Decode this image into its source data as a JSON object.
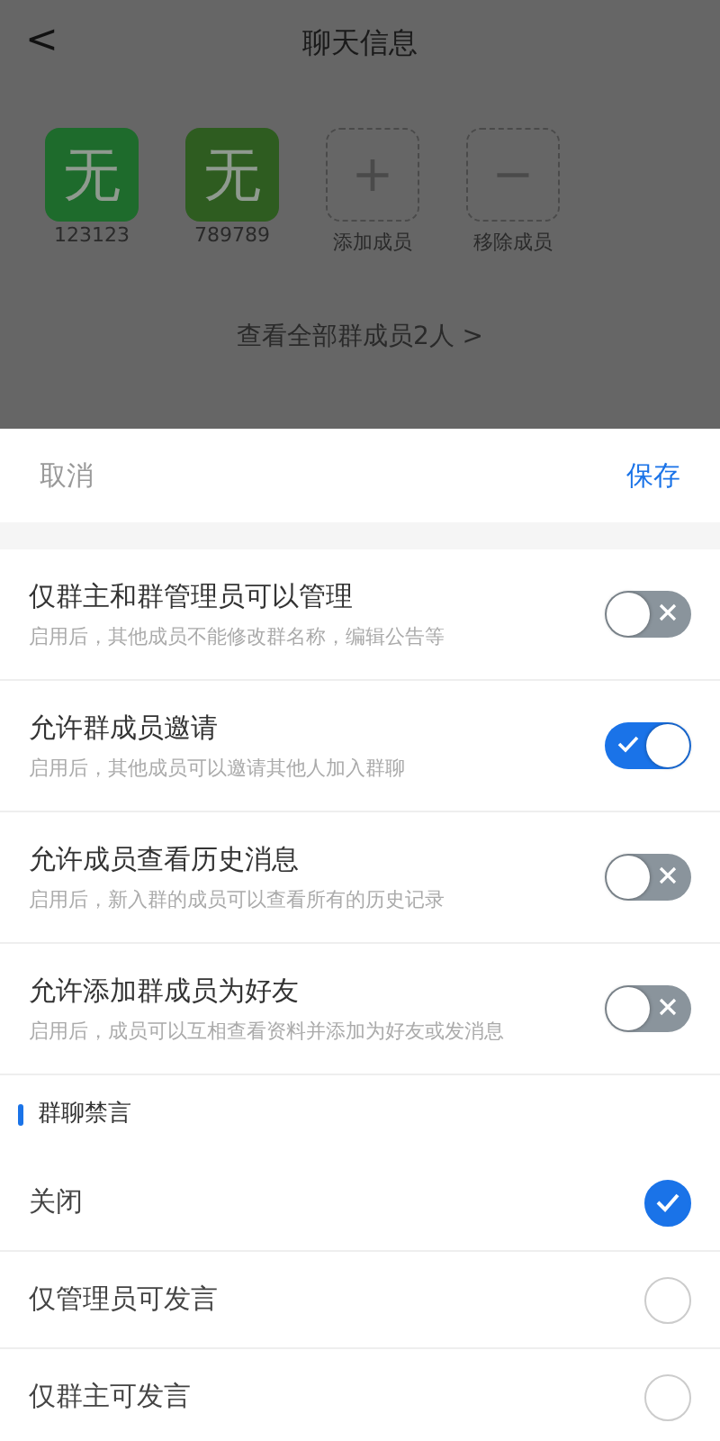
{
  "header": {
    "back": "<",
    "title": "聊天信息"
  },
  "members": [
    {
      "kind": "avatar",
      "glyph": "无",
      "label": "123123",
      "color": "#1e6b2c"
    },
    {
      "kind": "avatar",
      "glyph": "无",
      "label": "789789",
      "color": "#2e5c20"
    },
    {
      "kind": "add",
      "glyph": "+",
      "label": "添加成员"
    },
    {
      "kind": "remove",
      "glyph": "−",
      "label": "移除成员"
    }
  ],
  "view_all": {
    "text": "查看全部群成员2人",
    "chevron": ">"
  },
  "sheet": {
    "cancel": "取消",
    "save": "保存",
    "settings": [
      {
        "title": "仅群主和群管理员可以管理",
        "hint": "启用后，其他成员不能修改群名称，编辑公告等",
        "on": false
      },
      {
        "title": "允许群成员邀请",
        "hint": "启用后，其他成员可以邀请其他人加入群聊",
        "on": true
      },
      {
        "title": "允许成员查看历史消息",
        "hint": "启用后，新入群的成员可以查看所有的历史记录",
        "on": false
      },
      {
        "title": "允许添加群成员为好友",
        "hint": "启用后，成员可以互相查看资料并添加为好友或发消息",
        "on": false
      }
    ],
    "mute_section": "群聊禁言",
    "mute_options": [
      {
        "label": "关闭",
        "selected": true
      },
      {
        "label": "仅管理员可发言",
        "selected": false
      },
      {
        "label": "仅群主可发言",
        "selected": false
      }
    ]
  }
}
